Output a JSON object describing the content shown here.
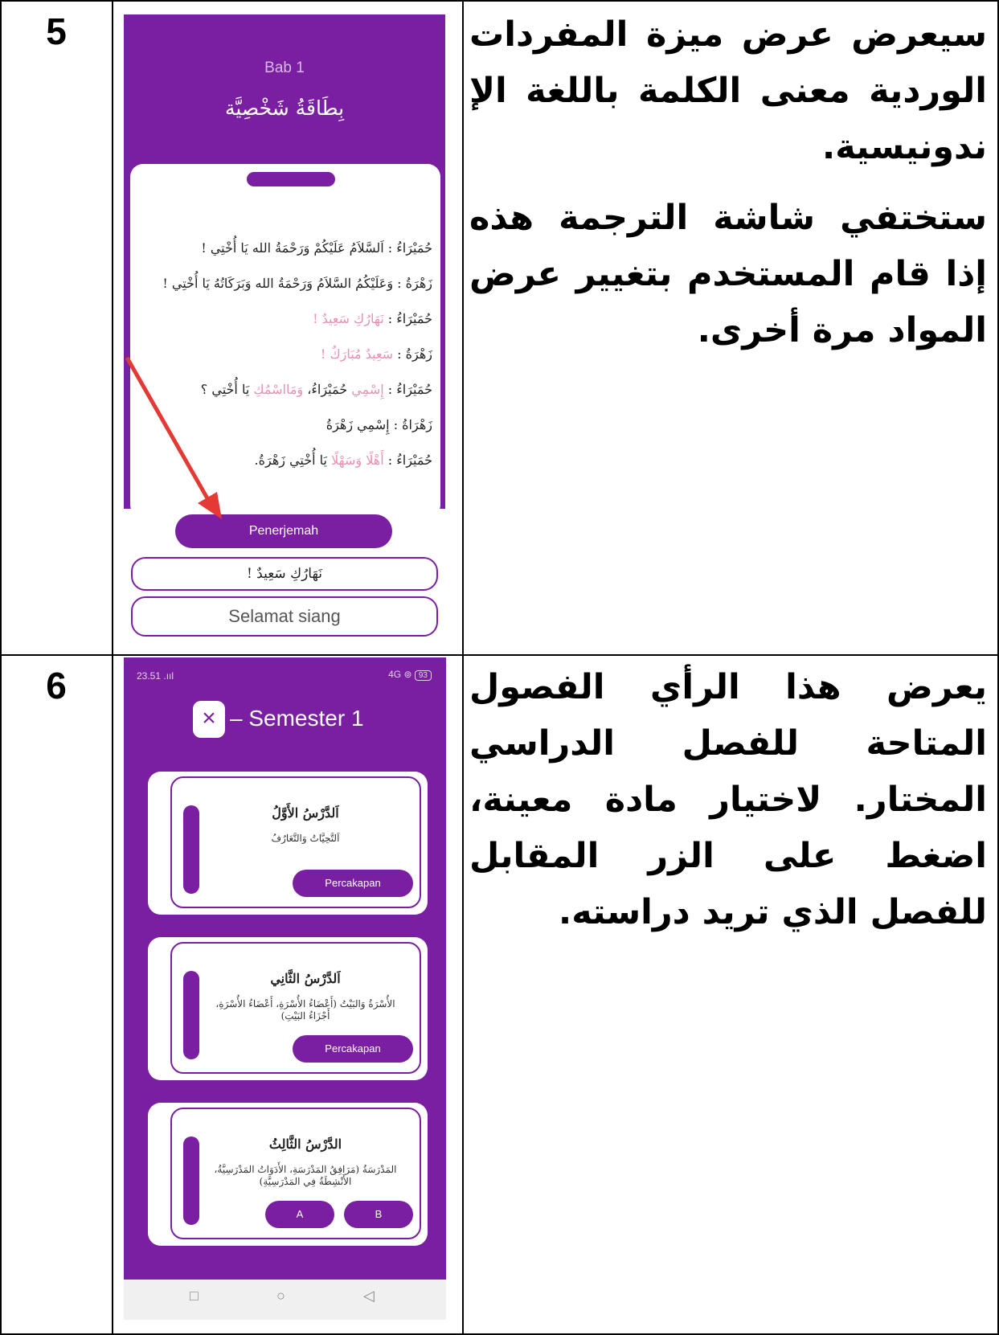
{
  "rows": [
    {
      "number": "5",
      "description": [
        "سيعرض عرض ميزة المفردات الوردية معنى الكلمة باللغة الإ ندونيسية.",
        "ستختفي شاشة الترجمة هذه إذا قام المستخدم بتغيير عرض المواد مرة أخرى."
      ]
    },
    {
      "number": "6",
      "description": [
        "يعرض هذا الرأي الفصول المتاحة للفصل الدراسي المختار. لاختيار مادة معينة، اضغط على الزر المقابل للفصل الذي تريد دراسته."
      ]
    }
  ],
  "phone1": {
    "chapter": "Bab 1",
    "title": "بِطَاقَةُ شَخْصِيَّة",
    "dialogue": [
      {
        "speaker": "حُمَيْرَاءُ :",
        "parts": [
          {
            "t": "اَلسَّلاَمُ عَلَيْكُمْ وَرَحْمَةُ الله يَا أُخْتِي !",
            "pink": false
          }
        ]
      },
      {
        "speaker": "زَهْرَةُ :",
        "parts": [
          {
            "t": "وَعَلَيْكُمُ السَّلاَمُ وَرَحْمَةُ الله وَبَرَكَاتُهُ يَا أُخْتِي !",
            "pink": false
          }
        ]
      },
      {
        "speaker": "حُمَيْرَاءُ :",
        "parts": [
          {
            "t": "نَهَارُكِ سَعِيدٌ !",
            "pink": true
          }
        ]
      },
      {
        "speaker": "زَهْرَةُ :",
        "parts": [
          {
            "t": "سَعِيدٌ مُبَارَكٌ !",
            "pink": true
          }
        ]
      },
      {
        "speaker": "حُمَيْرَاءُ :",
        "parts": [
          {
            "t": "إِسْمِي",
            "pink": true
          },
          {
            "t": " حُمَيْرَاءُ، ",
            "pink": false
          },
          {
            "t": "وَمَااسْمُكِ",
            "pink": true
          },
          {
            "t": " يَا أُخْتِي ؟",
            "pink": false
          }
        ]
      },
      {
        "speaker": "زَهْرَاةُ :",
        "parts": [
          {
            "t": "إِسْمِي زَهْرَةُ",
            "pink": false
          }
        ]
      },
      {
        "speaker": "حُمَيْرَاءُ :",
        "parts": [
          {
            "t": "أَهْلًا وَسَهْلًا",
            "pink": true
          },
          {
            "t": " يَا أُخْتِي زَهْرَةُ.",
            "pink": false
          }
        ]
      }
    ],
    "translator_button": "Penerjemah",
    "arabic_word": "نَهَارُكِ سَعِيدٌ !",
    "translation": "Selamat siang"
  },
  "phone2": {
    "status_time": "23.51",
    "status_signal": ".ııl",
    "status_right": "4G ⊚",
    "battery": "93",
    "close_label": "×",
    "semester_title": "– Semester 1",
    "lessons": [
      {
        "title": "اَلدَّرْسُ الأَوَّلُ",
        "subtitle": "اَلتَّحِيَّاتُ وَالتَّعَارُفُ",
        "buttons": [
          "Percakapan"
        ]
      },
      {
        "title": "اَلدَّرْسُ الثَّانِي",
        "subtitle": "الأُسْرَةُ وَالبَيْتُ (أَعْضَاءُ الأُسْرَةِ، أَعْضَاءُ الأُسْرَةِ، أَجْزَاءُ البَيْتِ)",
        "buttons": [
          "Percakapan"
        ]
      },
      {
        "title": "الدَّرْسُ الثَّالِثُ",
        "subtitle": "المَدْرَسَةُ (مَرَافِقُ المَدْرَسَةِ، الأَدَوَاتُ المَدْرَسِيَّةُ، الأَنْشِطَةُ فِي المَدْرَسِيَّةِ)",
        "buttons": [
          "B",
          "A"
        ]
      }
    ],
    "nav": [
      "□",
      "○",
      "◁"
    ]
  },
  "colors": {
    "primary": "#7b1fa2",
    "pink": "#e98fb3",
    "arrow": "#e53935"
  }
}
